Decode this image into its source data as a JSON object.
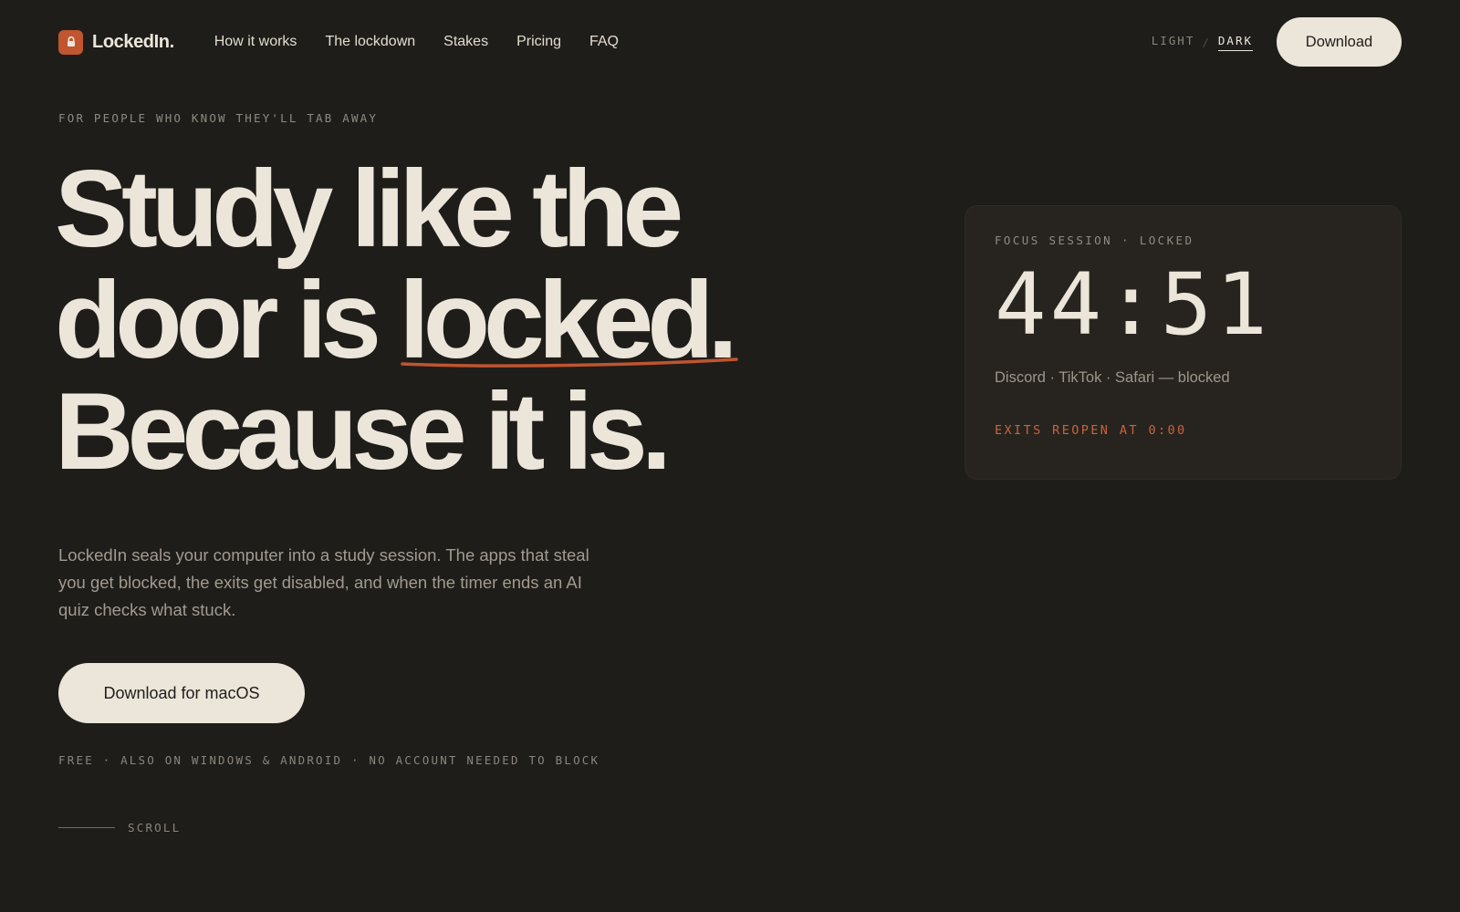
{
  "brand": {
    "name": "LockedIn.",
    "accent_color": "#c0552f",
    "logo_icon": "lock-icon"
  },
  "nav": {
    "items": [
      {
        "label": "How it works"
      },
      {
        "label": "The lockdown"
      },
      {
        "label": "Stakes"
      },
      {
        "label": "Pricing"
      },
      {
        "label": "FAQ"
      }
    ]
  },
  "theme_toggle": {
    "light_label": "LIGHT",
    "separator": "/",
    "dark_label": "DARK",
    "selected": "DARK"
  },
  "header": {
    "download_label": "Download"
  },
  "hero": {
    "eyebrow": "FOR PEOPLE WHO KNOW THEY'LL TAB AWAY",
    "headline_line1": "Study like the",
    "headline_line2_prefix": "door is ",
    "headline_line2_emphasis": "locked.",
    "headline_line3": "Because it is.",
    "lede": "LockedIn seals your computer into a study session. The apps that steal you get blocked, the exits get disabled, and when the timer ends an AI quiz checks what stuck.",
    "cta_label": "Download for macOS",
    "fineprint": "FREE · ALSO ON WINDOWS & ANDROID · NO ACCOUNT NEEDED TO BLOCK",
    "scroll_label": "SCROLL"
  },
  "focus_card": {
    "eyebrow": "FOCUS SESSION · LOCKED",
    "timer": "44:51",
    "blocked_apps": "Discord · TikTok · Safari — blocked",
    "exits_note": "EXITS REOPEN AT 0:00",
    "exits_color": "#c8633c"
  },
  "colors": {
    "background": "#1f1d1a",
    "foreground": "#ece6da",
    "card": "#27241f"
  }
}
